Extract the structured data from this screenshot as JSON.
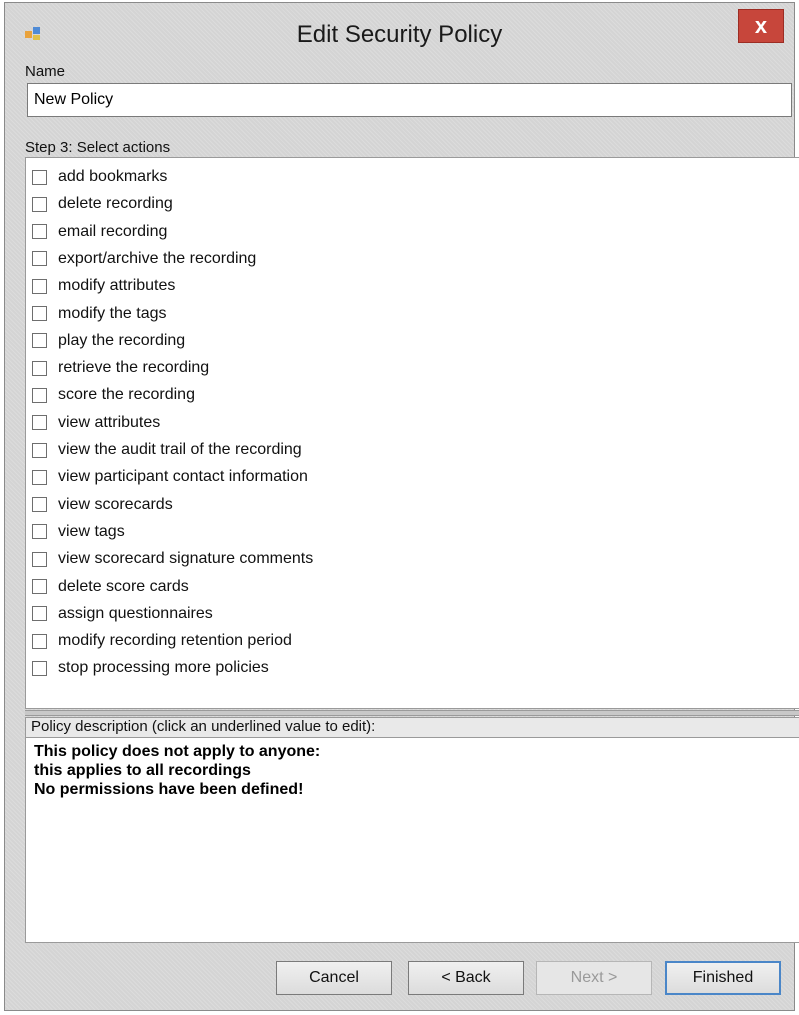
{
  "window": {
    "title": "Edit Security Policy",
    "close_label": "x"
  },
  "name_section": {
    "label": "Name",
    "value": "New Policy"
  },
  "actions_section": {
    "label": "Step 3: Select actions",
    "items": [
      {
        "label": "add bookmarks",
        "checked": false
      },
      {
        "label": "delete recording",
        "checked": false
      },
      {
        "label": "email recording",
        "checked": false
      },
      {
        "label": "export/archive the recording",
        "checked": false
      },
      {
        "label": "modify attributes",
        "checked": false
      },
      {
        "label": "modify the tags",
        "checked": false
      },
      {
        "label": "play the recording",
        "checked": false
      },
      {
        "label": "retrieve the recording",
        "checked": false
      },
      {
        "label": "score the recording",
        "checked": false
      },
      {
        "label": "view attributes",
        "checked": false
      },
      {
        "label": "view the audit trail of the recording",
        "checked": false
      },
      {
        "label": "view participant contact information",
        "checked": false
      },
      {
        "label": "view scorecards",
        "checked": false
      },
      {
        "label": "view tags",
        "checked": false
      },
      {
        "label": "view scorecard signature comments",
        "checked": false
      },
      {
        "label": "delete score cards",
        "checked": false
      },
      {
        "label": "assign questionnaires",
        "checked": false
      },
      {
        "label": "modify recording retention period",
        "checked": false
      },
      {
        "label": "stop processing more policies",
        "checked": false
      }
    ]
  },
  "description_section": {
    "label": "Policy description (click an underlined value to edit):",
    "lines": [
      "This policy does not apply to anyone:",
      "this applies to all recordings",
      "No permissions have been defined!"
    ]
  },
  "buttons": {
    "cancel": "Cancel",
    "back": "< Back",
    "next": "Next >",
    "finished": "Finished"
  }
}
